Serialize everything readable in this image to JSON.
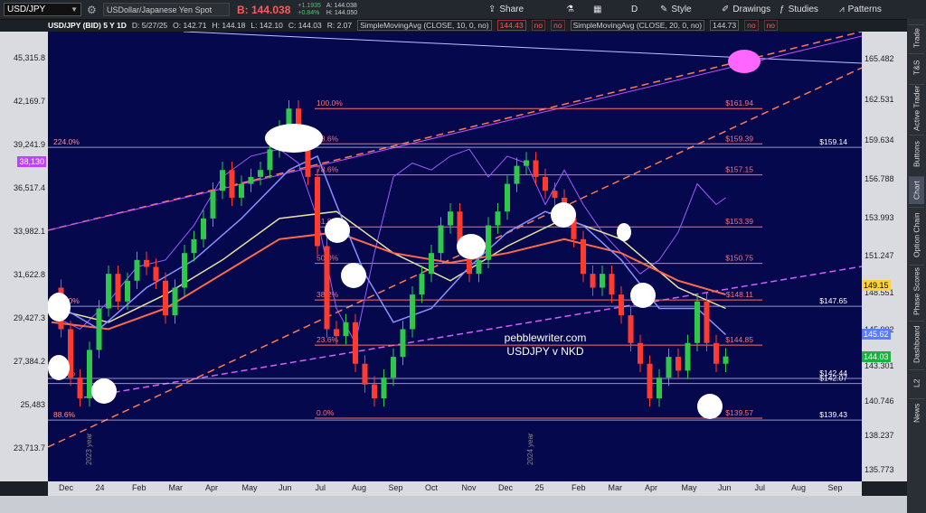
{
  "toolbar": {
    "symbol": "USD/JPY",
    "description": "USDollar/Japanese Yen Spot",
    "bid_label": "B: 144.038",
    "change_line1": "+1.1935",
    "change_line2": "+0.84%",
    "ask_line1": "A: 144.038",
    "ask_line2": "H: 144.050",
    "share": "Share",
    "period": "D",
    "style": "Style",
    "drawings": "Drawings",
    "studies": "Studies",
    "patterns": "Patterns"
  },
  "header": {
    "title": "USD/JPY (BID) 5 Y 1D",
    "date": "D: 5/27/25",
    "open": "O: 142.71",
    "high": "H: 144.18",
    "low": "L: 142.10",
    "close": "C: 144.03",
    "r": "R: 2.07",
    "sma1": "SimpleMovingAvg (CLOSE, 10, 0, no)",
    "sma1_val": "144.43",
    "no": "no",
    "sma2": "SimpleMovingAvg (CLOSE, 20, 0, no)",
    "sma2_val": "144.73"
  },
  "side_tabs": [
    "Trade",
    "T&S",
    "Active Trader",
    "Buttons",
    "Chart",
    "Option Chain",
    "Phase Scores",
    "Dashboard",
    "L2",
    "News"
  ],
  "colors": {
    "background": "#06084d",
    "price_up": "#2fc84a",
    "price_down": "#ff3b30",
    "fib": "#ff7070",
    "nkd": "#a05cff",
    "sma_fast": "#8890ff",
    "sma_slow": "#ff6a4a",
    "sma_mid": "#e8e0a0"
  },
  "chart_data": {
    "type": "candlestick",
    "annotation_line1": "pebblewriter.com",
    "annotation_line2": "USDJPY v NKD",
    "x_ticks": [
      "Dec",
      "24",
      "Feb",
      "Mar",
      "Apr",
      "May",
      "Jun",
      "Jul",
      "Aug",
      "Sep",
      "Oct",
      "Nov",
      "Dec",
      "25",
      "Feb",
      "Mar",
      "Apr",
      "May",
      "Jun",
      "Jul",
      "Aug",
      "Sep"
    ],
    "year_labels": [
      "2023 year",
      "2024 year"
    ],
    "right_axis_ticks": [
      165.482,
      162.531,
      159.634,
      156.788,
      153.993,
      151.247,
      148.551,
      145.902,
      143.301,
      140.746,
      138.237,
      135.773
    ],
    "left_axis_ticks": [
      "45,315.8",
      "42,169.7",
      "39,241.9",
      "36,517.4",
      "33,982.1",
      "31,622.8",
      "29,427.3",
      "27,384.2",
      "25,483",
      "23,713.7"
    ],
    "left_tag": "38,130",
    "right_tags": [
      {
        "label": "149.15",
        "color": "#ffd23c"
      },
      {
        "label": "145.62",
        "color": "#5a7cff"
      },
      {
        "label": "144.03",
        "color": "#19b23c"
      }
    ],
    "fib_left": [
      {
        "pct": "100.0%",
        "price": 161.94,
        "label": "$161.94"
      },
      {
        "pct": "88.6%",
        "price": 159.39,
        "label": "$159.39"
      },
      {
        "pct": "78.6%",
        "price": 157.15,
        "label": "$157.15"
      },
      {
        "pct": "61.8%",
        "price": 153.39,
        "label": "$153.39"
      },
      {
        "pct": "50.0%",
        "price": 150.75,
        "label": "$150.75"
      },
      {
        "pct": "38.2%",
        "price": 148.11,
        "label": "$148.11"
      },
      {
        "pct": "23.6%",
        "price": 144.85,
        "label": "$144.85"
      },
      {
        "pct": "0.0%",
        "price": 139.57,
        "label": "$139.57"
      }
    ],
    "fib_outer": [
      {
        "pct": "224.0%",
        "price": 159.14,
        "label": "$159.14"
      },
      {
        "pct": "100.0%",
        "price": 147.65,
        "label": "$147.65"
      },
      {
        "pct": "38.2%",
        "price": 142.44,
        "label": "$142.44"
      },
      {
        "pct": "",
        "price": 142.07,
        "label": "$142.07"
      },
      {
        "pct": "88.6%",
        "price": 139.43,
        "label": "$139.43"
      }
    ],
    "ylim": [
      135.0,
      167.5
    ],
    "price_path": [
      [
        0,
        149.0
      ],
      [
        1,
        146.0
      ],
      [
        2,
        142.5
      ],
      [
        3,
        141.0
      ],
      [
        4,
        144.5
      ],
      [
        5,
        147.5
      ],
      [
        6,
        150.0
      ],
      [
        7,
        148.0
      ],
      [
        8,
        149.5
      ],
      [
        9,
        151.0
      ],
      [
        10,
        150.5
      ],
      [
        11,
        149.5
      ],
      [
        12,
        147.0
      ],
      [
        13,
        149.0
      ],
      [
        14,
        151.5
      ],
      [
        15,
        152.5
      ],
      [
        16,
        154.0
      ],
      [
        17,
        156.0
      ],
      [
        18,
        157.5
      ],
      [
        19,
        155.5
      ],
      [
        20,
        156.5
      ],
      [
        21,
        157.0
      ],
      [
        22,
        157.5
      ],
      [
        23,
        159.0
      ],
      [
        24,
        160.5
      ],
      [
        25,
        161.94
      ],
      [
        26,
        160.0
      ],
      [
        27,
        157.0
      ],
      [
        28,
        152.0
      ],
      [
        29,
        146.0
      ],
      [
        30,
        145.5
      ],
      [
        31,
        146.5
      ],
      [
        32,
        143.5
      ],
      [
        33,
        142.0
      ],
      [
        34,
        141.0
      ],
      [
        35,
        142.5
      ],
      [
        36,
        144.0
      ],
      [
        37,
        146.0
      ],
      [
        38,
        148.5
      ],
      [
        39,
        150.0
      ],
      [
        40,
        151.5
      ],
      [
        41,
        153.5
      ],
      [
        42,
        154.5
      ],
      [
        43,
        152.0
      ],
      [
        44,
        150.0
      ],
      [
        45,
        151.0
      ],
      [
        46,
        153.5
      ],
      [
        47,
        154.5
      ],
      [
        48,
        156.5
      ],
      [
        49,
        157.8
      ],
      [
        50,
        158.2
      ],
      [
        51,
        157.0
      ],
      [
        52,
        156.0
      ],
      [
        53,
        155.5
      ],
      [
        54,
        154.0
      ],
      [
        55,
        152.5
      ],
      [
        56,
        150.0
      ],
      [
        57,
        149.0
      ],
      [
        58,
        150.0
      ],
      [
        59,
        148.5
      ],
      [
        60,
        147.0
      ],
      [
        61,
        145.0
      ],
      [
        62,
        143.5
      ],
      [
        63,
        141.0
      ],
      [
        64,
        142.5
      ],
      [
        65,
        144.0
      ],
      [
        66,
        143.0
      ],
      [
        67,
        145.0
      ],
      [
        68,
        148.0
      ],
      [
        69,
        145.0
      ],
      [
        70,
        143.5
      ],
      [
        71,
        144.03
      ]
    ],
    "nkd_path": [
      [
        0,
        147.0
      ],
      [
        3,
        146.0
      ],
      [
        6,
        148.0
      ],
      [
        9,
        150.5
      ],
      [
        12,
        151.0
      ],
      [
        15,
        153.5
      ],
      [
        18,
        157.0
      ],
      [
        21,
        158.5
      ],
      [
        24,
        159.0
      ],
      [
        26,
        158.0
      ],
      [
        28,
        154.0
      ],
      [
        30,
        147.5
      ],
      [
        32,
        145.0
      ],
      [
        34,
        151.5
      ],
      [
        36,
        157.0
      ],
      [
        38,
        158.0
      ],
      [
        40,
        157.5
      ],
      [
        42,
        158.5
      ],
      [
        44,
        159.0
      ],
      [
        46,
        157.0
      ],
      [
        48,
        158.5
      ],
      [
        50,
        158.0
      ],
      [
        52,
        155.0
      ],
      [
        54,
        157.5
      ],
      [
        56,
        155.0
      ],
      [
        58,
        153.0
      ],
      [
        60,
        151.5
      ],
      [
        62,
        150.0
      ],
      [
        64,
        151.0
      ],
      [
        66,
        153.0
      ],
      [
        68,
        156.5
      ],
      [
        70,
        155.0
      ],
      [
        71,
        155.5
      ]
    ],
    "sma_fast_path": [
      [
        0,
        148.0
      ],
      [
        5,
        146.0
      ],
      [
        10,
        149.0
      ],
      [
        15,
        151.0
      ],
      [
        20,
        154.0
      ],
      [
        25,
        157.5
      ],
      [
        28,
        158.5
      ],
      [
        30,
        155.0
      ],
      [
        33,
        150.0
      ],
      [
        36,
        146.5
      ],
      [
        40,
        147.5
      ],
      [
        44,
        150.5
      ],
      [
        48,
        153.0
      ],
      [
        52,
        154.5
      ],
      [
        56,
        153.5
      ],
      [
        60,
        151.0
      ],
      [
        64,
        147.5
      ],
      [
        68,
        147.5
      ],
      [
        71,
        145.6
      ]
    ],
    "sma_slow_path": [
      [
        0,
        146.5
      ],
      [
        6,
        146.0
      ],
      [
        12,
        147.5
      ],
      [
        18,
        150.0
      ],
      [
        24,
        152.5
      ],
      [
        30,
        153.0
      ],
      [
        36,
        151.5
      ],
      [
        42,
        150.8
      ],
      [
        48,
        151.5
      ],
      [
        54,
        152.5
      ],
      [
        60,
        151.5
      ],
      [
        66,
        149.5
      ],
      [
        71,
        148.5
      ]
    ],
    "sma_mid_path": [
      [
        0,
        147.5
      ],
      [
        6,
        146.5
      ],
      [
        12,
        148.5
      ],
      [
        18,
        151.0
      ],
      [
        24,
        154.0
      ],
      [
        30,
        154.5
      ],
      [
        36,
        151.5
      ],
      [
        42,
        149.5
      ],
      [
        48,
        152.0
      ],
      [
        54,
        154.0
      ],
      [
        60,
        152.5
      ],
      [
        66,
        149.0
      ],
      [
        71,
        147.5
      ]
    ]
  }
}
